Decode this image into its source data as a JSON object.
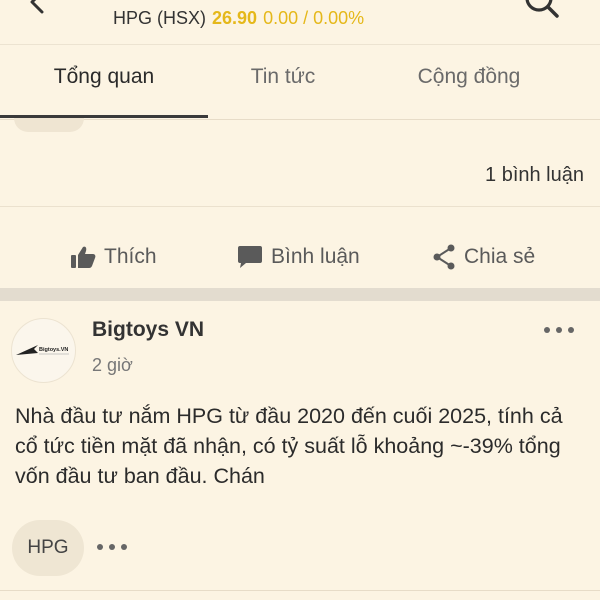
{
  "header": {
    "symbol": "HPG (HSX)",
    "price": "26.90",
    "change": "0.00 / 0.00%",
    "price_color": "#e5b81a"
  },
  "tabs": [
    {
      "label": "Tổng quan",
      "active": true
    },
    {
      "label": "Tin tức",
      "active": false
    },
    {
      "label": "Cộng đồng",
      "active": false
    }
  ],
  "previous_post": {
    "comment_count": "1 bình luận"
  },
  "actions": {
    "like": {
      "label": "Thích",
      "icon": "thumbs-up-icon"
    },
    "comment": {
      "label": "Bình luận",
      "icon": "comment-icon"
    },
    "share": {
      "label": "Chia sẻ",
      "icon": "share-icon"
    }
  },
  "post": {
    "author": "Bigtoys VN",
    "avatar_text": "Bigtoys VN",
    "time": "2 giờ",
    "body": "Nhà đầu tư nắm HPG từ đầu 2020 đến cuối 2025, tính cả cổ tức tiền mặt đã nhận, có tỷ suất lỗ khoảng ~-39% tổng vốn đầu tư ban đầu. Chán",
    "tags": [
      "HPG"
    ]
  }
}
